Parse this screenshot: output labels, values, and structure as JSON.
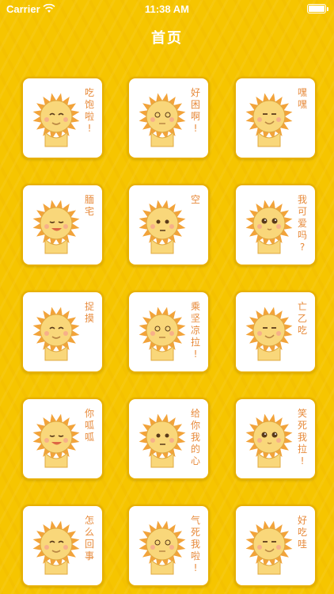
{
  "status_bar": {
    "carrier": "Carrier",
    "time": "11:38 AM"
  },
  "nav": {
    "title": "首页"
  },
  "stickers": [
    {
      "id": 1,
      "caption": "吃饱啦!",
      "icon": "lion-eating-icon"
    },
    {
      "id": 2,
      "caption": "好困啊!",
      "icon": "lion-sleepy-icon"
    },
    {
      "id": 3,
      "caption": "嘿嘿",
      "icon": "lion-smirk-icon"
    },
    {
      "id": 4,
      "caption": "腼宅",
      "icon": "lion-shy-icon"
    },
    {
      "id": 5,
      "caption": "空",
      "icon": "lion-blank-icon"
    },
    {
      "id": 6,
      "caption": "我可爱吗?",
      "icon": "lion-cute-icon"
    },
    {
      "id": 7,
      "caption": "捉摸",
      "icon": "lion-dance-icon"
    },
    {
      "id": 8,
      "caption": "乘 坚 凉 拉!",
      "icon": "lion-cool-icon"
    },
    {
      "id": 9,
      "caption": "亡乙吃",
      "icon": "lion-kiss-icon"
    },
    {
      "id": 10,
      "caption": "你呱呱",
      "icon": "lion-watermelon-icon"
    },
    {
      "id": 11,
      "caption": "给你我的心",
      "icon": "lion-heart-icon"
    },
    {
      "id": 12,
      "caption": "笑死我拉!",
      "icon": "lion-laugh-icon"
    },
    {
      "id": 13,
      "caption": "怎么回事",
      "icon": "lion-cry-icon"
    },
    {
      "id": 14,
      "caption": "气死我啦!",
      "icon": "lion-angry-icon"
    },
    {
      "id": 15,
      "caption": "好吃哇",
      "icon": "lion-melon-icon"
    }
  ],
  "colors": {
    "background": "#f6c500",
    "mane": "#f2a33a",
    "face": "#f9d77a",
    "text": "#e78a3b"
  }
}
